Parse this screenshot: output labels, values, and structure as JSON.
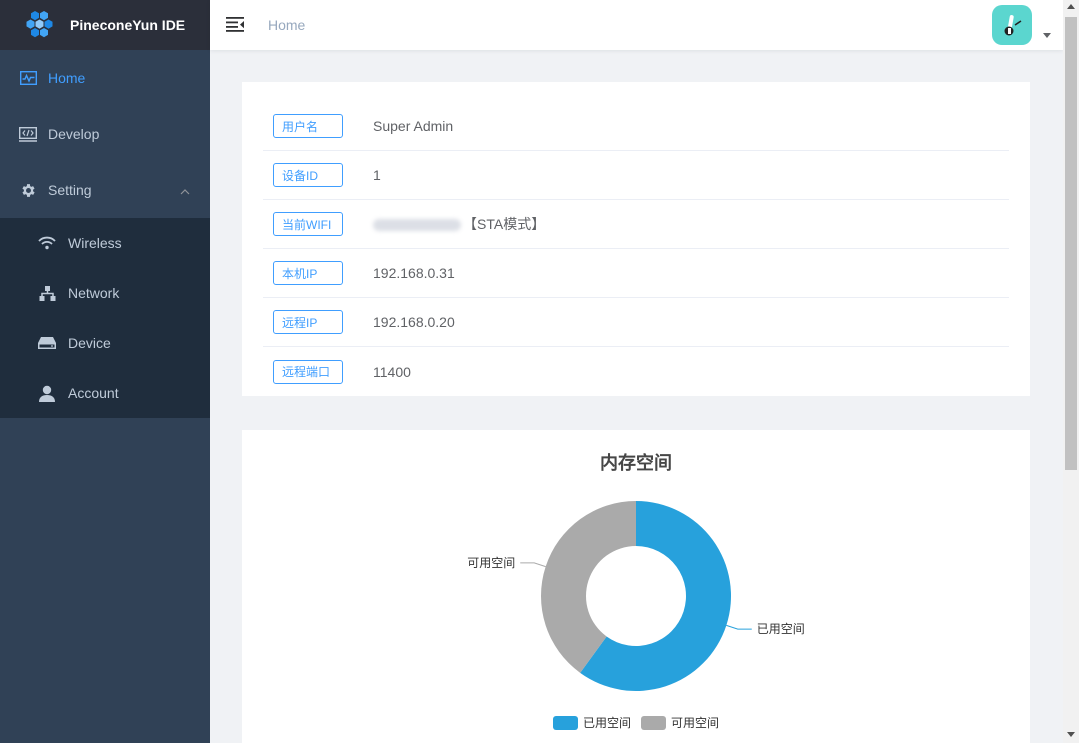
{
  "app": {
    "title": "PineconeYun IDE"
  },
  "header": {
    "breadcrumb": "Home"
  },
  "sidebar": {
    "items": [
      {
        "label": "Home"
      },
      {
        "label": "Develop"
      },
      {
        "label": "Setting"
      }
    ],
    "subitems": [
      {
        "label": "Wireless"
      },
      {
        "label": "Network"
      },
      {
        "label": "Device"
      },
      {
        "label": "Account"
      }
    ]
  },
  "info": {
    "rows": [
      {
        "tag": "用户名",
        "value": "Super Admin"
      },
      {
        "tag": "设备ID",
        "value": "1"
      },
      {
        "tag": "当前WIFI",
        "value": "【STA模式】"
      },
      {
        "tag": "本机IP",
        "value": "192.168.0.31"
      },
      {
        "tag": "远程IP",
        "value": "192.168.0.20"
      },
      {
        "tag": "远程端口",
        "value": "11400"
      }
    ]
  },
  "colors": {
    "accent": "#409eff",
    "used": "#27a1dc",
    "free": "#aaaaaa",
    "sidebar": "#304156",
    "submenu": "#1f2d3d"
  },
  "chart_data": {
    "type": "pie",
    "title": "内存空间",
    "categories": [
      "已用空间",
      "可用空间"
    ],
    "values": [
      60,
      40
    ],
    "colors": [
      "#27a1dc",
      "#aaaaaa"
    ],
    "legend": "bottom"
  }
}
